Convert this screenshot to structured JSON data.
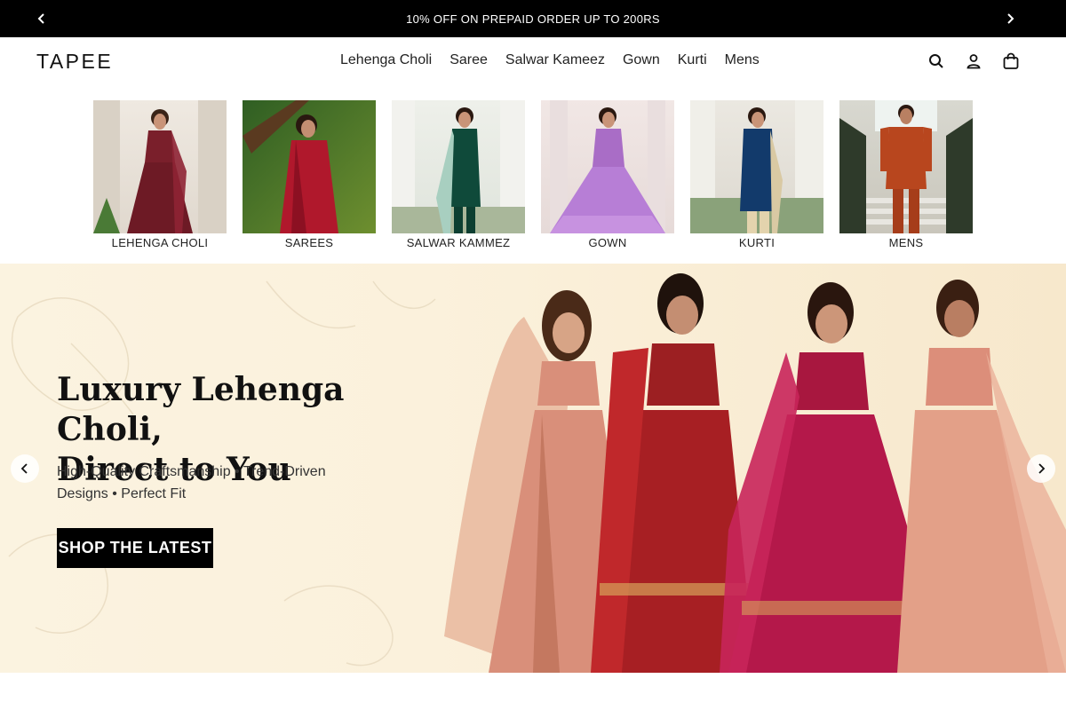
{
  "announcement": {
    "text": "10% OFF ON PREPAID ORDER UP TO 200RS",
    "prev_icon": "chevron-left-icon",
    "next_icon": "chevron-right-icon"
  },
  "header": {
    "logo": "TAPEE",
    "nav": [
      "Lehenga Choli",
      "Saree",
      "Salwar Kameez",
      "Gown",
      "Kurti",
      "Mens"
    ],
    "icons": [
      "search-icon",
      "account-icon",
      "cart-bag-icon"
    ]
  },
  "categories": [
    {
      "label": "LEHENGA CHOLI",
      "outfit_color": "#7a1f2b",
      "bg": "#e8e2da"
    },
    {
      "label": "SAREES",
      "outfit_color": "#b0182c",
      "bg": "#3f6b2a"
    },
    {
      "label": "SALWAR KAMMEZ",
      "outfit_color": "#0f4a3a",
      "bg": "#e9ece6"
    },
    {
      "label": "GOWN",
      "outfit_color": "#b77ed6",
      "bg": "#efe4e4"
    },
    {
      "label": "KURTI",
      "outfit_color": "#123a6b",
      "bg": "#e6e3dc"
    },
    {
      "label": "MENS",
      "outfit_color": "#b8461e",
      "bg": "#d9d5cc"
    }
  ],
  "hero": {
    "title_line1": "Luxury Lehenga Choli,",
    "title_line2": "Direct to You",
    "subtitle_line1": "High-Quality Craftsmanship • Trend-Driven",
    "subtitle_line2": "Designs  • Perfect Fit",
    "cta": "SHOP THE LATEST",
    "model_colors": [
      "#d98f7a",
      "#a71f23",
      "#b4184a",
      "#e3a088"
    ],
    "bg": "#fbf3e0"
  }
}
